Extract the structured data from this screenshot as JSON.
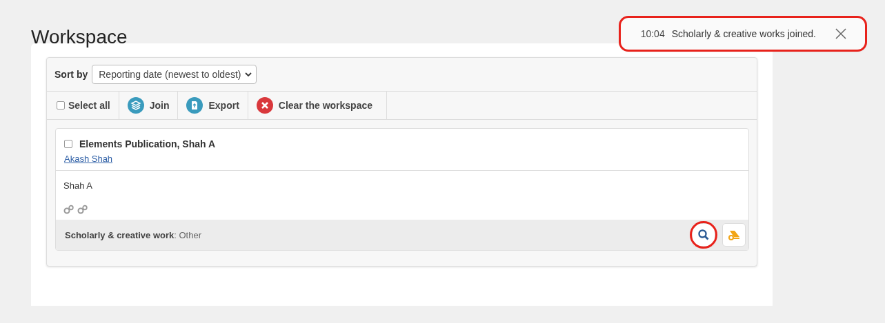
{
  "page": {
    "title": "Workspace"
  },
  "toast": {
    "time": "10:04",
    "message": "Scholarly & creative works joined."
  },
  "sort": {
    "label": "Sort by",
    "value": "Reporting date (newest to oldest)"
  },
  "toolbar": {
    "select_all": {
      "label": "Select all",
      "checked": false
    },
    "actions": [
      {
        "kind": "join",
        "label": "Join"
      },
      {
        "kind": "export",
        "label": "Export"
      },
      {
        "kind": "clear",
        "label": "Clear the workspace"
      }
    ]
  },
  "items": [
    {
      "title": "Elements Publication, Shah A",
      "checked": false,
      "link": "Akash Shah",
      "authors": "Shah A",
      "footer": "**Scholarly & creative work**: Other"
    }
  ]
}
